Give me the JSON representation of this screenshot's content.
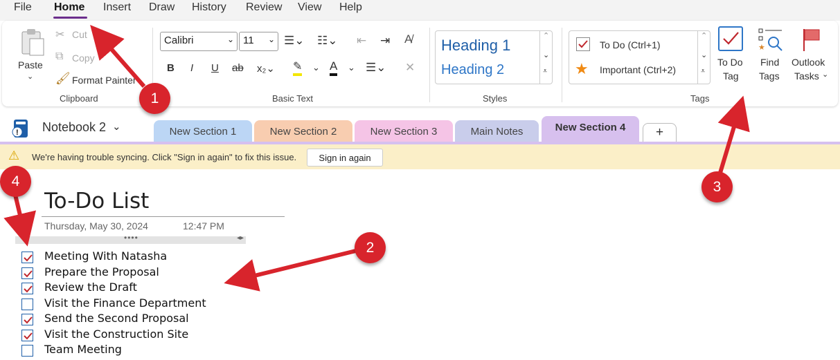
{
  "menu": {
    "items": [
      "File",
      "Home",
      "Insert",
      "Draw",
      "History",
      "Review",
      "View",
      "Help"
    ]
  },
  "clipboard": {
    "paste": "Paste",
    "cut": "Cut",
    "copy": "Copy",
    "format_painter": "Format Painter",
    "label": "Clipboard"
  },
  "basic_text": {
    "font": "Calibri",
    "size": "11",
    "label": "Basic Text"
  },
  "styles": {
    "heading1": "Heading 1",
    "heading2": "Heading 2",
    "label": "Styles"
  },
  "tags": {
    "todo": "To Do (Ctrl+1)",
    "important": "Important (Ctrl+2)",
    "label": "Tags",
    "todo_tag_line1": "To Do",
    "todo_tag_line2": "Tag",
    "find_tags_line1": "Find",
    "find_tags_line2": "Tags",
    "outlook_line1": "Outlook",
    "outlook_line2": "Tasks"
  },
  "notebook": {
    "name": "Notebook 2"
  },
  "sections": [
    {
      "label": "New Section 1",
      "color": "#bcd6f5"
    },
    {
      "label": "New Section 2",
      "color": "#f8cdb0"
    },
    {
      "label": "New Section 3",
      "color": "#f5c4e6"
    },
    {
      "label": "Main Notes",
      "color": "#c9cdeb"
    },
    {
      "label": "New Section 4",
      "color": "#d7c0ee"
    }
  ],
  "add_section": "+",
  "sync_warning": {
    "message": "We're having trouble syncing. Click \"Sign in again\" to fix this issue.",
    "button": "Sign in again"
  },
  "page": {
    "title": "To-Do List",
    "date": "Thursday, May 30, 2024",
    "time": "12:47 PM"
  },
  "todo_items": [
    {
      "text": "Meeting With Natasha",
      "checked": true
    },
    {
      "text": "Prepare the Proposal",
      "checked": true
    },
    {
      "text": "Review the Draft",
      "checked": true
    },
    {
      "text": "Visit the Finance Department",
      "checked": false
    },
    {
      "text": "Send the Second Proposal",
      "checked": true
    },
    {
      "text": "Visit the Construction Site",
      "checked": true
    },
    {
      "text": "Team Meeting",
      "checked": false
    }
  ],
  "annotations": [
    "1",
    "2",
    "3",
    "4"
  ],
  "colors": {
    "accent": "#6b2d8c",
    "annotation_red": "#d8242c",
    "checkmark": "#c0282e",
    "warning_bg": "#fbefc8"
  }
}
